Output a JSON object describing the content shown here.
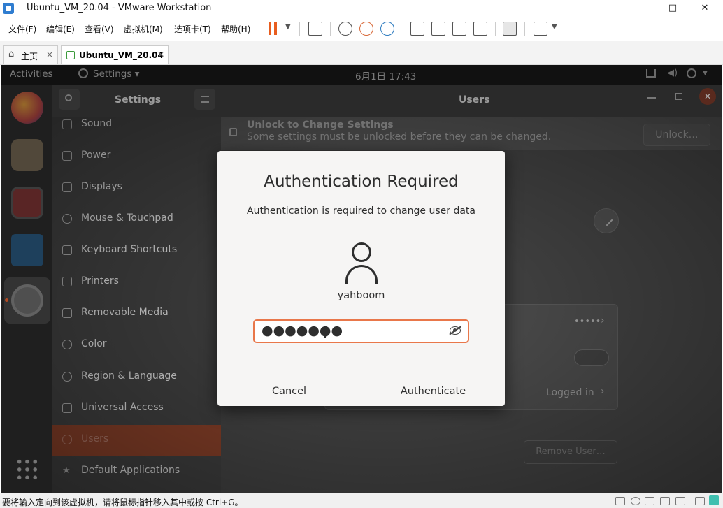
{
  "window": {
    "title": "Ubuntu_VM_20.04 - VMware Workstation",
    "minimize": "—",
    "maximize": "□",
    "close": "✕"
  },
  "menu": {
    "items": [
      "文件(F)",
      "编辑(E)",
      "查看(V)",
      "虚拟机(M)",
      "选项卡(T)",
      "帮助(H)"
    ]
  },
  "tabs": {
    "home": "主页",
    "vm": "Ubuntu_VM_20.04",
    "close": "×"
  },
  "guest_topbar": {
    "activities": "Activities",
    "app_menu": "Settings ▾",
    "clock": "6月1日  17:43"
  },
  "settings": {
    "title": "Settings",
    "panel_title": "Users",
    "sidebar": [
      "Sound",
      "Power",
      "Displays",
      "Mouse & Touchpad",
      "Keyboard Shortcuts",
      "Printers",
      "Removable Media",
      "Color",
      "Region & Language",
      "Universal Access",
      "Users",
      "Default Applications"
    ],
    "selected": "Users",
    "unlock_title": "Unlock to Change Settings",
    "unlock_sub": "Some settings must be unlocked before they can be changed.",
    "unlock_button": "Unlock…",
    "password_value": "•••••",
    "last_login": "Logged in",
    "remove_user": "Remove User…"
  },
  "dialog": {
    "title": "Authentication Required",
    "message": "Authentication is required to change user data",
    "username": "yahboom",
    "password_dots": "●●●●●●●",
    "cancel": "Cancel",
    "authenticate": "Authenticate"
  },
  "statusbar": {
    "hint": "要将输入定向到该虚拟机，请将鼠标指针移入其中或按 Ctrl+G。"
  },
  "colors": {
    "accent": "#e9774a",
    "selected_row": "#7b3a25"
  }
}
